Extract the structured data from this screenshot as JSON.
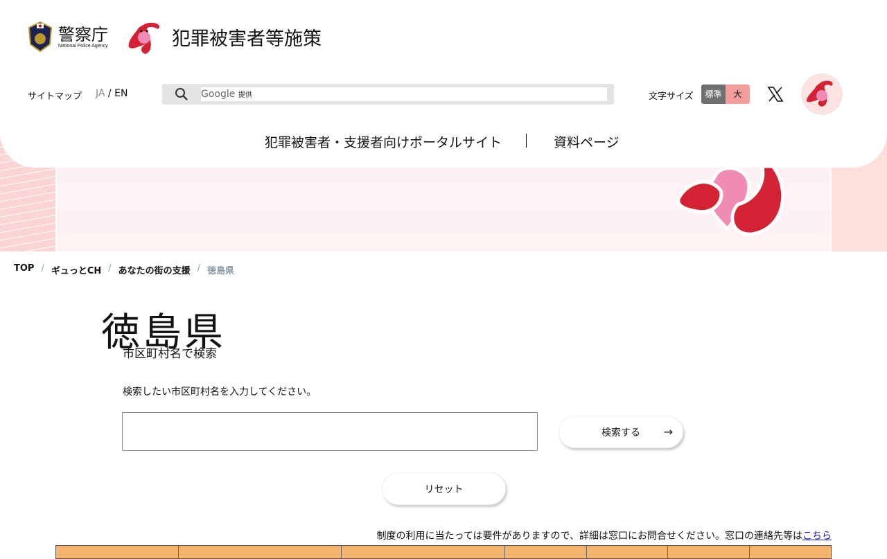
{
  "header": {
    "npa_name": "警察庁",
    "npa_sub": "National Police Agency",
    "site_title": "犯罪被害者等施策",
    "sitemap": "サイトマップ",
    "lang_ja": "JA",
    "lang_sep": "/",
    "lang_en": "EN",
    "search": {
      "google": "Google",
      "provided": "提供",
      "icon": "search-icon"
    },
    "font_size_label": "文字サイズ",
    "font_size_standard": "標準",
    "font_size_large": "大",
    "nav": [
      "犯罪被害者・支援者向けポータルサイト",
      "資料ページ"
    ]
  },
  "hero": {
    "title": "徳島県"
  },
  "breadcrumb": [
    "TOP",
    "ギュっとCH",
    "あなたの街の支援",
    "徳島県"
  ],
  "search_section": {
    "heading": "市区町村名で検索",
    "instruction": "検索したい市区町村名を入力してください。",
    "input_value": "",
    "submit": "検索する",
    "reset": "リセット"
  },
  "note": {
    "text": "制度の利用に当たっては要件がありますので、詳細は窓口にお問合せください。窓口の連絡先等は",
    "link": "こちら"
  },
  "colors": {
    "table_header": "#f4b46c",
    "font_std": "#707070",
    "font_large": "#f59c9c",
    "mascot_red": "#d22233",
    "mascot_pink": "#f08cb4"
  }
}
